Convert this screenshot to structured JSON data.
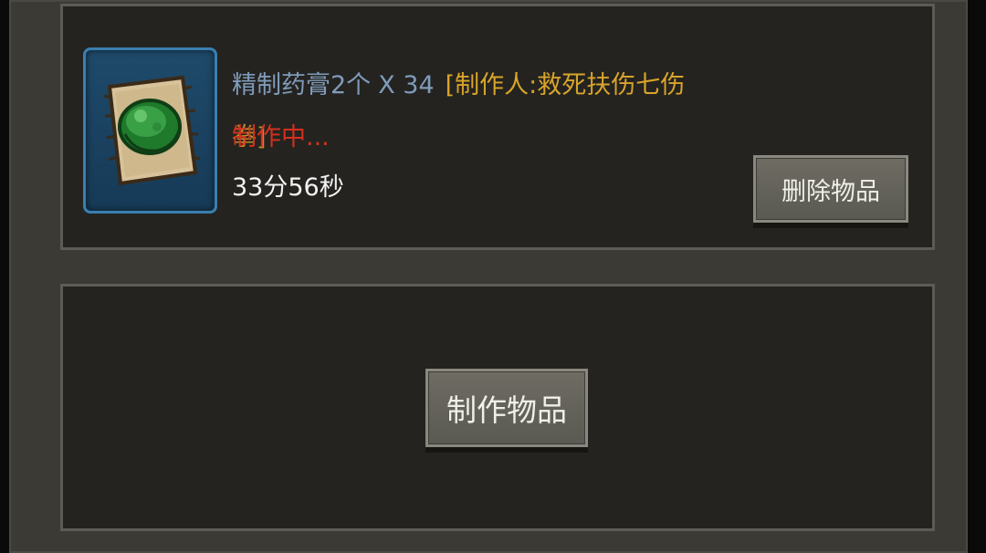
{
  "crafting_queue": {
    "slot_1": {
      "item": {
        "icon": "green-salve-on-cloth-icon",
        "name": "精制药膏2个",
        "multiplier": "X 34",
        "crafter_prefix": "[制作人:救死扶伤七伤",
        "crafter_suffix": "拳]",
        "status": "制作中...",
        "timer": "33分56秒"
      },
      "delete_label": "删除物品"
    },
    "slot_2": {
      "craft_label": "制作物品"
    }
  },
  "colors": {
    "panel_bg": "#242320",
    "frame": "#3b3a35",
    "item_name": "#7f9bb9",
    "crafter": "#d8a42a",
    "status": "#d3301f",
    "item_frame_border": "#3b7fb0"
  }
}
